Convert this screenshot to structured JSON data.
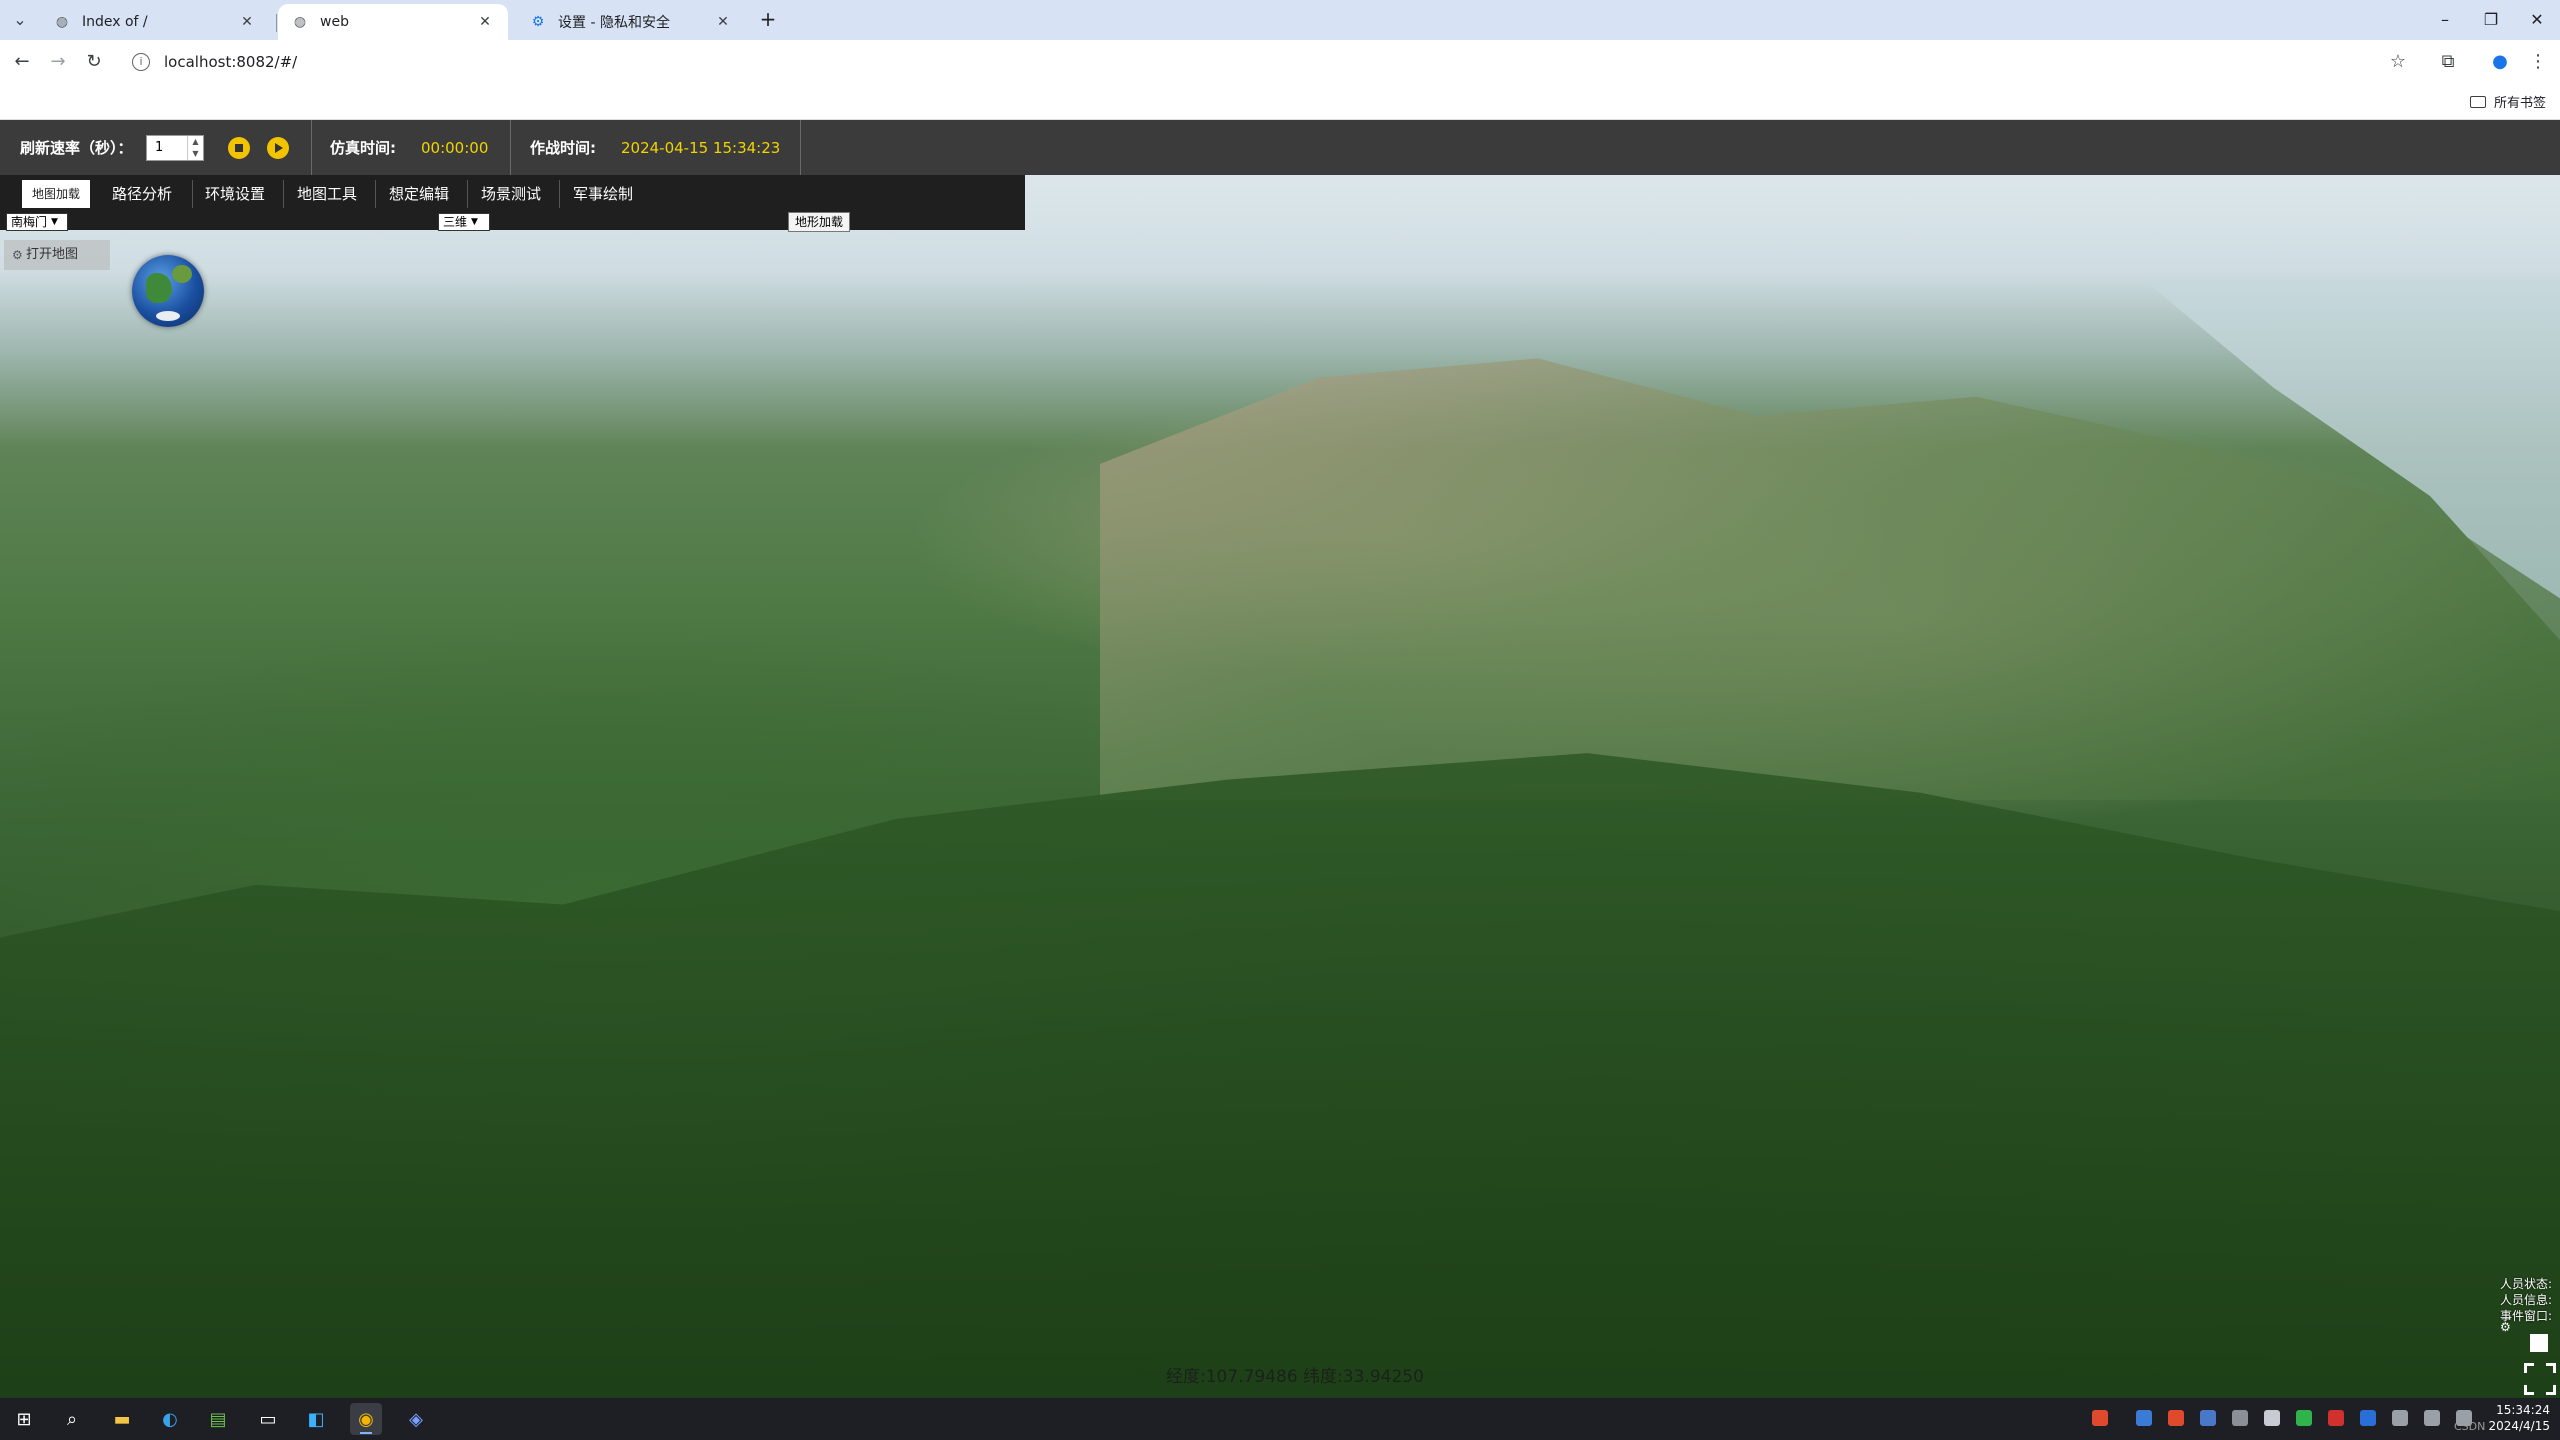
{
  "browser": {
    "tabs": [
      {
        "label": "Index of /",
        "icon": "globe-icon",
        "active": false
      },
      {
        "label": "web",
        "icon": "globe-icon",
        "active": true
      },
      {
        "label": "设置 - 隐私和安全",
        "icon": "gear-icon",
        "active": false
      }
    ],
    "url": "localhost:8082/#/",
    "all_bookmarks": "所有书签"
  },
  "control_bar": {
    "refresh_label": "刷新速率（秒）：",
    "refresh_value": "1",
    "sim_time_label": "仿真时间:",
    "sim_time_value": "00:00:00",
    "combat_time_label": "作战时间:",
    "combat_time_value": "2024-04-15 15:34:23"
  },
  "menu": {
    "tabs": [
      "地图加载",
      "路径分析",
      "环境设置",
      "地图工具",
      "想定编辑",
      "场景测试",
      "军事绘制"
    ],
    "select_region": "南梅门",
    "select_dimension": "三维",
    "terrain_load_button": "地形加载"
  },
  "map": {
    "open_map_label": "打开地图",
    "coords_text": "经度:107.79486 纬度:33.94250"
  },
  "status_panel": {
    "lines": [
      "人员状态:",
      "人员信息:",
      "事件窗口:"
    ]
  },
  "taskbar": {
    "time": "15:34:24",
    "date": "2024/4/15",
    "watermark": "CSDN"
  },
  "colors": {
    "accent_yellow": "#f2d400",
    "control_bar_bg": "#3b3b3b",
    "menu_bg": "#1f1f1f"
  }
}
